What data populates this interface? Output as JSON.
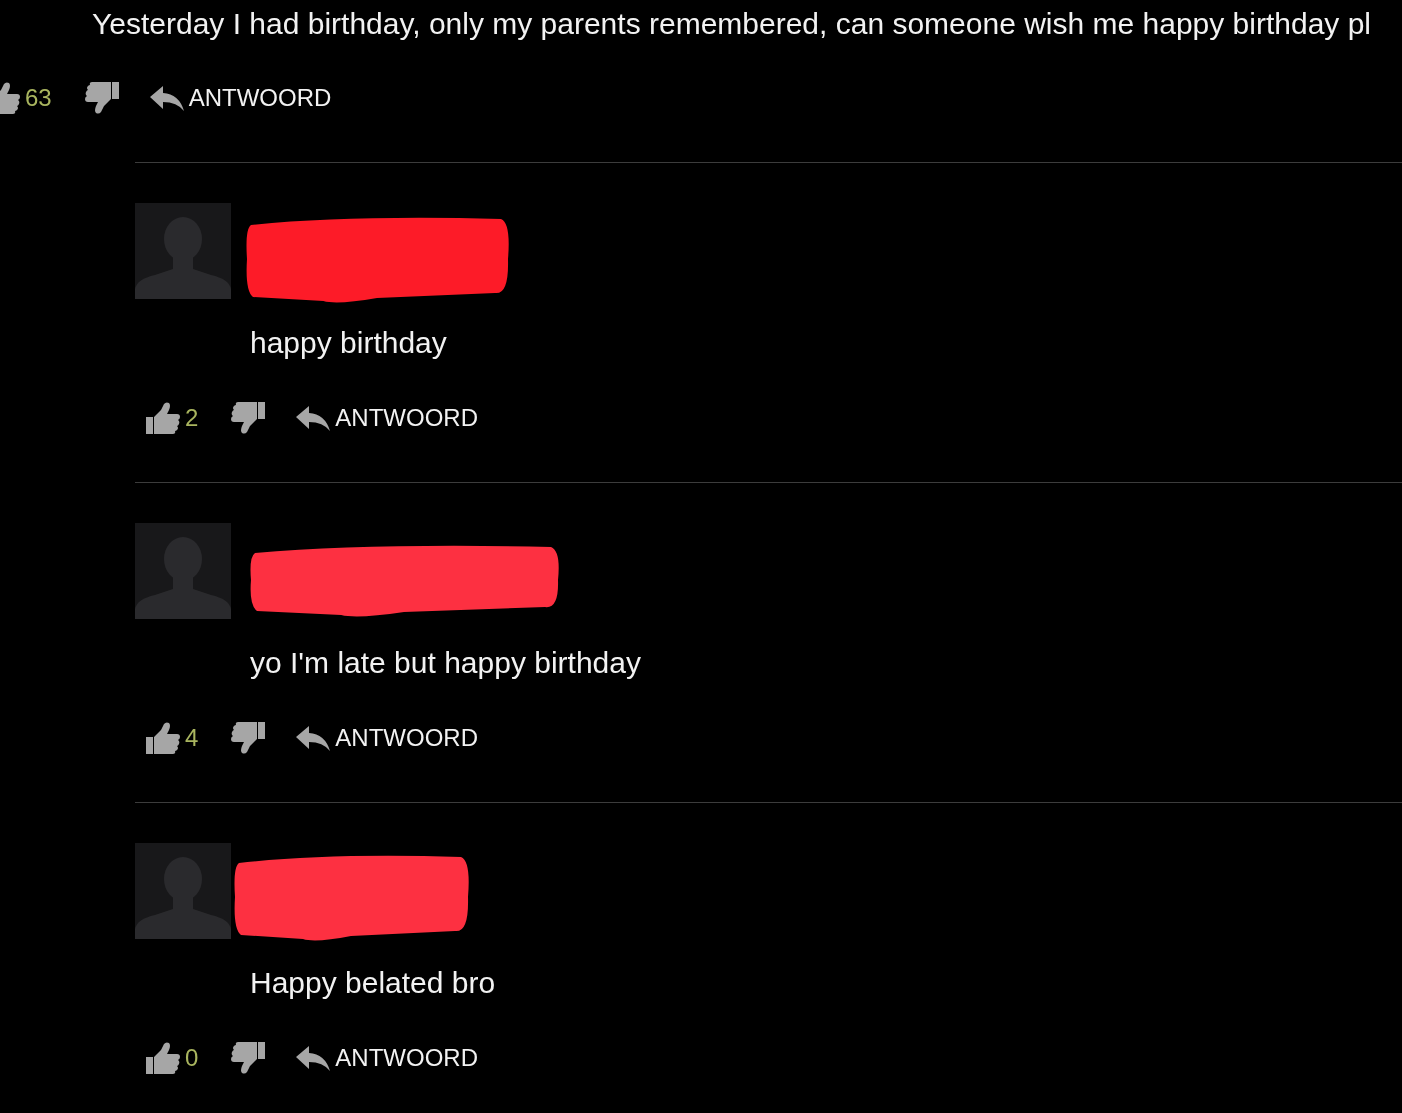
{
  "post": {
    "text": "Yesterday I had birthday, only my parents remembered, can someone wish me happy birthday pl",
    "likes": "63",
    "reply_label": "ANTWOORD"
  },
  "replies": [
    {
      "name_redacted": true,
      "text": "happy birthday",
      "likes": "2",
      "reply_label": "ANTWOORD"
    },
    {
      "name_redacted": true,
      "text": "yo I'm late but happy birthday",
      "likes": "4",
      "reply_label": "ANTWOORD"
    },
    {
      "name_redacted": true,
      "text": "Happy belated bro",
      "likes": "0",
      "reply_label": "ANTWOORD"
    }
  ]
}
